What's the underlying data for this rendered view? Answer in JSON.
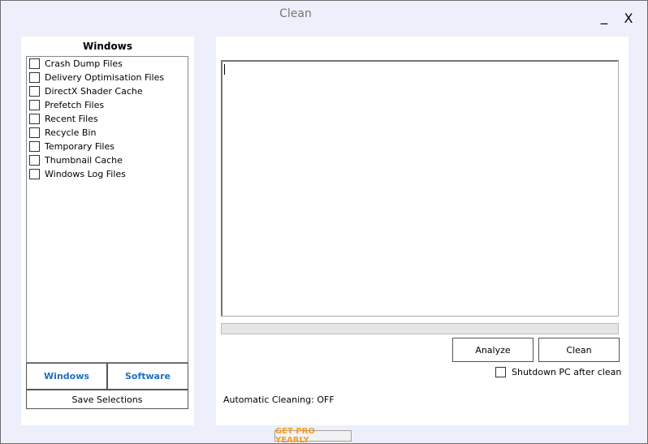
{
  "window": {
    "title": "Clean",
    "minimize": "_",
    "close": "X"
  },
  "left_panel": {
    "title": "Windows",
    "items": [
      {
        "label": "Crash Dump Files",
        "checked": false
      },
      {
        "label": "Delivery Optimisation Files",
        "checked": false
      },
      {
        "label": "DirectX Shader Cache",
        "checked": false
      },
      {
        "label": "Prefetch Files",
        "checked": false
      },
      {
        "label": "Recent Files",
        "checked": false
      },
      {
        "label": "Recycle Bin",
        "checked": false
      },
      {
        "label": "Temporary Files",
        "checked": false
      },
      {
        "label": "Thumbnail Cache",
        "checked": false
      },
      {
        "label": "Windows Log Files",
        "checked": false
      }
    ],
    "tabs": {
      "windows": "Windows",
      "software": "Software"
    },
    "save_label": "Save Selections"
  },
  "right_panel": {
    "log_text": "",
    "progress": 0,
    "analyze_label": "Analyze",
    "clean_label": "Clean",
    "shutdown_label": "Shutdown PC after clean",
    "shutdown_checked": false,
    "auto_cleaning": "Automatic Cleaning: OFF"
  },
  "promo": {
    "label": "GET PRO YEARLY"
  },
  "colors": {
    "accent": "#1f6fc0",
    "promo": "#f0a020",
    "background": "#edf0fb"
  }
}
